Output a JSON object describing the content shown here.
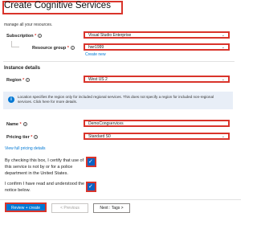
{
  "page": {
    "title": "Create Cognitive Services",
    "subtitle": "manage all your resources."
  },
  "project": {
    "subscription_label": "Subscription",
    "subscription_value": "Visual Studio Enterprise",
    "resource_group_label": "Resource group",
    "resource_group_value": "hwr1999",
    "create_new_link": "Create new"
  },
  "instance": {
    "section_title": "Instance details",
    "region_label": "Region",
    "region_value": "West US 2",
    "notice_text": "Location specifies the region only for included regional services. This does not specify a region for included non-regional services. Click here for more details.",
    "name_label": "Name",
    "name_value": "DemoCongservices",
    "pricing_label": "Pricing tier",
    "pricing_value": "Standard S0",
    "pricing_link": "View full pricing details"
  },
  "checks": {
    "responsible_ai": "By checking this box, I certify that use of this service is not by or for a police department in the United States.",
    "notice_read": "I confirm I have read and understood the notice below."
  },
  "footer": {
    "create_label": "Review + create",
    "previous_label": "< Previous",
    "next_label": "Next : Tags >"
  },
  "colors": {
    "highlight": "#d9342b",
    "primary": "#0078d4"
  }
}
